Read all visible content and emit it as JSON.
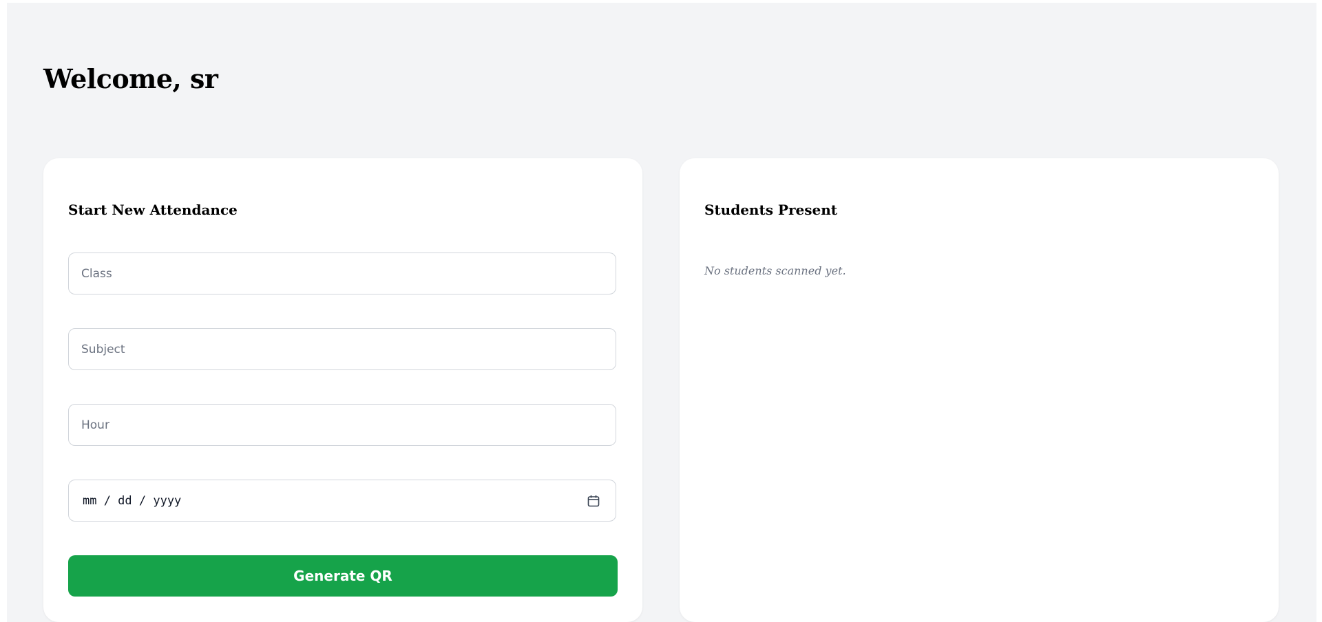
{
  "header": {
    "welcome": "Welcome, sr"
  },
  "attendance_form": {
    "title": "Start New Attendance",
    "class_placeholder": "Class",
    "subject_placeholder": "Subject",
    "hour_placeholder": "Hour",
    "date_placeholder": "mm / dd / yyyy",
    "date_icon": "calendar-icon",
    "generate_label": "Generate QR"
  },
  "students_panel": {
    "title": "Students Present",
    "empty_message": "No students scanned yet."
  },
  "colors": {
    "page_background": "#f3f4f6",
    "card_background": "#ffffff",
    "primary_button": "#16a34a",
    "field_border": "#d1d5db",
    "muted_text": "#6b7280"
  }
}
